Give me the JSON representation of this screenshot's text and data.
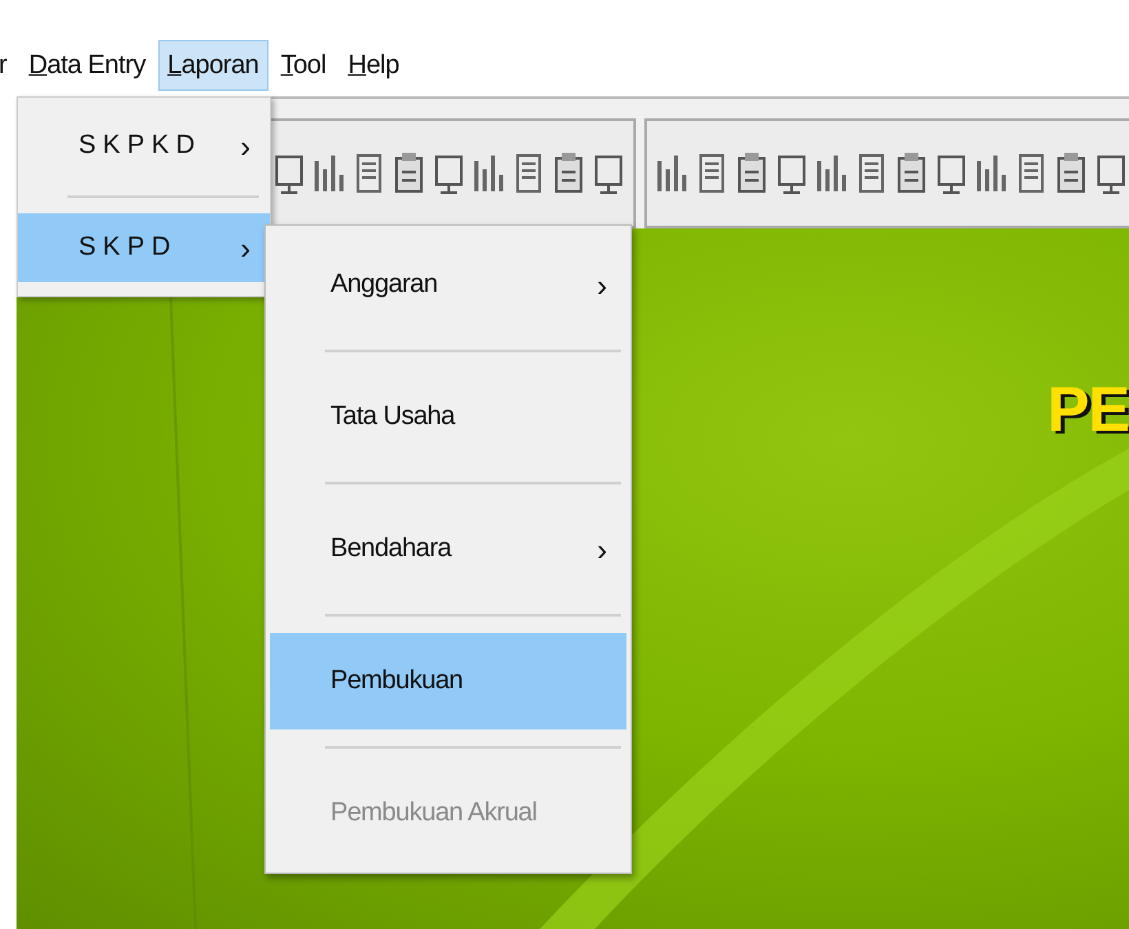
{
  "menu_bar": [
    {
      "label": "r",
      "selected": false,
      "underline_first": false
    },
    {
      "label": "Data Entry",
      "selected": false,
      "underline_first": true
    },
    {
      "label": "Laporan",
      "selected": true,
      "underline_first": true
    },
    {
      "label": "Tool",
      "selected": false,
      "underline_first": true
    },
    {
      "label": "Help",
      "selected": false,
      "underline_first": true
    }
  ],
  "laporan_menu": [
    {
      "label": "SKPKD",
      "submenu": true,
      "selected": false
    },
    {
      "label": "SKPD",
      "submenu": true,
      "selected": true
    }
  ],
  "skpd_submenu": [
    {
      "label": "Anggaran",
      "submenu": true,
      "selected": false,
      "disabled": false
    },
    {
      "label": "Tata Usaha",
      "submenu": false,
      "selected": false,
      "disabled": false
    },
    {
      "label": "Bendahara",
      "submenu": true,
      "selected": false,
      "disabled": false
    },
    {
      "label": "Pembukuan",
      "submenu": false,
      "selected": true,
      "disabled": false
    },
    {
      "label": "Pembukuan Akrual",
      "submenu": false,
      "selected": false,
      "disabled": true
    }
  ],
  "submenu_arrow": "›",
  "banner_title": "PE"
}
